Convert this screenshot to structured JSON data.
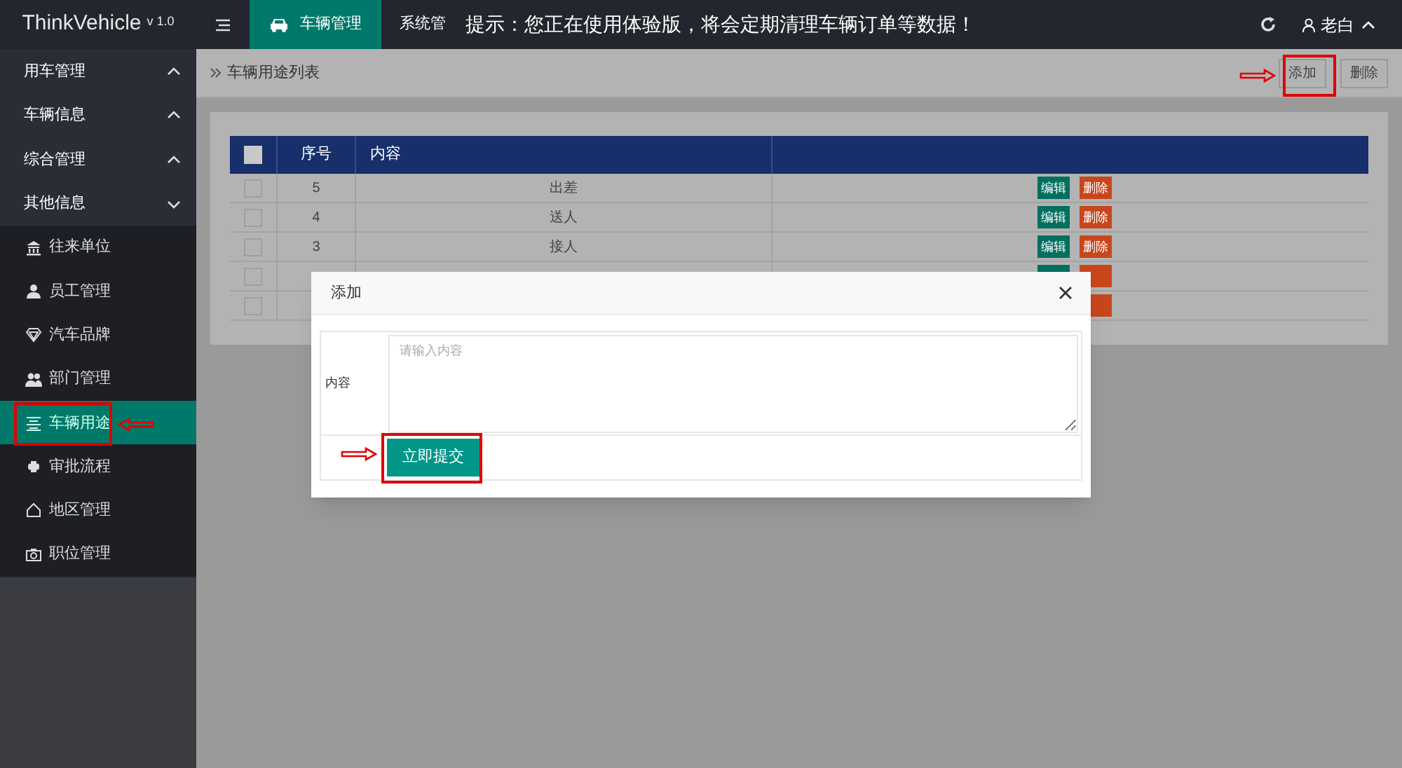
{
  "logo": {
    "name": "ThinkVehicle",
    "version": "v 1.0"
  },
  "topbar": {
    "tabs": [
      {
        "label": "车辆管理",
        "selected": true
      },
      {
        "label": "系统管",
        "selected": false
      }
    ],
    "notice": "提示：您正在使用体验版，将会定期清理车辆订单等数据！",
    "user": "老白"
  },
  "sidebar": {
    "groups": [
      {
        "label": "用车管理",
        "expanded": false
      },
      {
        "label": "车辆信息",
        "expanded": false
      },
      {
        "label": "综合管理",
        "expanded": false
      },
      {
        "label": "其他信息",
        "expanded": true,
        "children": [
          {
            "label": "往来单位",
            "selected": false
          },
          {
            "label": "员工管理",
            "selected": false
          },
          {
            "label": "汽车品牌",
            "selected": false
          },
          {
            "label": "部门管理",
            "selected": false
          },
          {
            "label": "车辆用途",
            "selected": true
          },
          {
            "label": "审批流程",
            "selected": false
          },
          {
            "label": "地区管理",
            "selected": false
          },
          {
            "label": "职位管理",
            "selected": false
          }
        ]
      }
    ]
  },
  "breadcrumb": "车辆用途列表",
  "toolbar": {
    "buttons": [
      "添加",
      "删除"
    ]
  },
  "table": {
    "all_checked": false,
    "columns": [
      "序号",
      "内容"
    ],
    "rows": [
      {
        "checked": false,
        "seq": "5",
        "content": "出差",
        "actions": [
          "编辑",
          "删除"
        ]
      },
      {
        "checked": false,
        "seq": "4",
        "content": "送人",
        "actions": [
          "编辑",
          "删除"
        ]
      },
      {
        "checked": false,
        "seq": "3",
        "content": "接人",
        "actions": [
          "编辑",
          "删除"
        ]
      },
      {
        "checked": false,
        "kind": "partial"
      },
      {
        "checked": false,
        "kind": "covered"
      }
    ]
  },
  "dialog": {
    "title": "添加",
    "field_label": "内容",
    "placeholder": "请输入内容",
    "submit": "立即提交"
  }
}
